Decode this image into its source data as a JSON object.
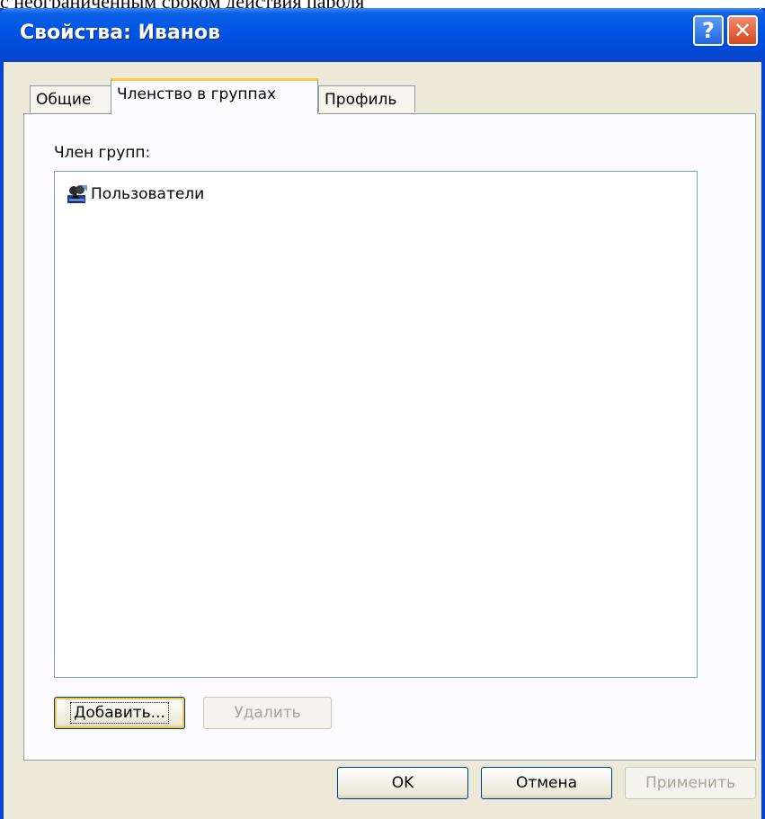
{
  "page_caption": "с неограниченным сроком действия пароля",
  "window": {
    "title": "Свойства: Иванов",
    "help_glyph": "?",
    "close_glyph": "✕"
  },
  "tabs": [
    {
      "label": "Общие",
      "active": false
    },
    {
      "label": "Членство в группах",
      "active": true
    },
    {
      "label": "Профиль",
      "active": false
    }
  ],
  "members": {
    "label": "Член групп:",
    "items": [
      {
        "name": "Пользователи",
        "icon": "user-group-icon"
      }
    ]
  },
  "buttons": {
    "add": "Добавить...",
    "remove": "Удалить",
    "ok": "OK",
    "cancel": "Отмена",
    "apply": "Применить"
  },
  "colors": {
    "titlebar": "#0054e3",
    "dialog_bg": "#ece9d8",
    "active_tab_accent": "#ffc83c",
    "close_button": "#d8451e"
  }
}
